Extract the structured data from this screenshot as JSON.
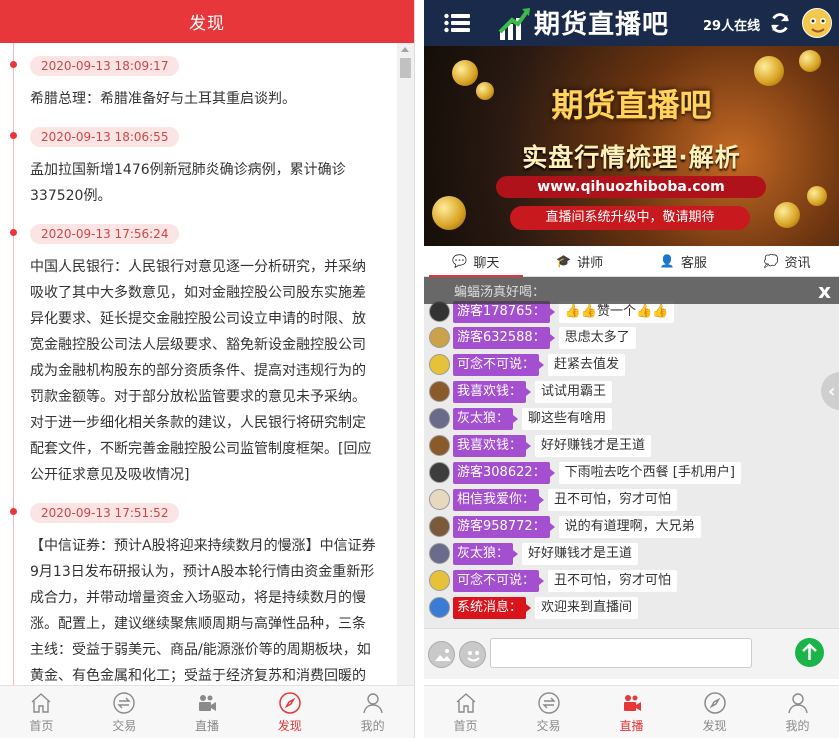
{
  "left": {
    "header_title": "发现",
    "news": [
      {
        "time": "2020-09-13 18:09:17",
        "text": "希腊总理：希腊准备好与土耳其重启谈判。"
      },
      {
        "time": "2020-09-13 18:06:55",
        "text": "孟加拉国新增1476例新冠肺炎确诊病例，累计确诊337520例。"
      },
      {
        "time": "2020-09-13 17:56:24",
        "text": "中国人民银行：人民银行对意见逐一分析研究，并采纳吸收了其中大多数意见，如对金融控股公司股东实施差异化要求、延长提交金融控股公司设立申请的时限、放宽金融控股公司法人层级要求、豁免新设金融控股公司成为金融机构股东的部分资质条件、提高对违规行为的罚款金额等。对于部分放松监管要求的意见未予采纳。对于进一步细化相关条款的建议，人民银行将研究制定配套文件，不断完善金融控股公司监管制度框架。[回应公开征求意见及吸收情况]"
      },
      {
        "time": "2020-09-13 17:51:52",
        "text": "【中信证券：预计A股将迎来持续数月的慢涨】中信证券9月13日发布研报认为，预计A股本轮行情由资金重新形成合力，并带动增量资金入场驱动，将是持续数月的慢涨。配置上，建议继续聚焦顺周期与高弹性品种，三条主线：受益于弱美元、商品/能源涨价等的周期板块，如黄金、有色金属和化工；受益于经济复苏和消费回暖的可选消费，如汽车、家电、家居等；绝"
      }
    ],
    "tabs": [
      {
        "label": "首页",
        "icon": "home-icon"
      },
      {
        "label": "交易",
        "icon": "exchange-icon"
      },
      {
        "label": "直播",
        "icon": "camera-icon"
      },
      {
        "label": "发现",
        "icon": "compass-icon"
      },
      {
        "label": "我的",
        "icon": "user-icon"
      }
    ],
    "active_tab": "发现"
  },
  "right": {
    "logo_text": "期货直播吧",
    "online_text": "29人在线",
    "banner": {
      "title": "期货直播吧",
      "subtitle": "实盘行情梳理·解析",
      "url": "www.qihuozhiboba.com",
      "notice": "直播间系统升级中，敬请期待"
    },
    "chat_tabs": [
      {
        "label": "聊天",
        "icon": "chat-icon"
      },
      {
        "label": "讲师",
        "icon": "graduation-cap-icon"
      },
      {
        "label": "客服",
        "icon": "user-icon"
      },
      {
        "label": "资讯",
        "icon": "comment-icon"
      }
    ],
    "marquee_text": "蝙蝠汤真好喝：",
    "close_label": "x",
    "messages": [
      {
        "name": "游客178765：",
        "text": "👍👍赞一个👍👍",
        "avatar_color": "#333333"
      },
      {
        "name": "游客632588：",
        "text": "思虑太多了",
        "avatar_color": "#c9a24a"
      },
      {
        "name": "可念不可说：",
        "text": "赶紧去值发",
        "avatar_color": "#e6c23a"
      },
      {
        "name": "我喜欢钱：",
        "text": "试试用霸王",
        "avatar_color": "#8b5a2b"
      },
      {
        "name": "灰太狼：",
        "text": "聊这些有啥用",
        "avatar_color": "#6a6a8a"
      },
      {
        "name": "我喜欢钱：",
        "text": "好好赚钱才是王道",
        "avatar_color": "#8b5a2b"
      },
      {
        "name": "游客308622：",
        "text": "下雨啦去吃个西餐 [手机用户]",
        "avatar_color": "#3d3d3d"
      },
      {
        "name": "相信我爱你：",
        "text": "丑不可怕，穷才可怕",
        "avatar_color": "#e8d8c0"
      },
      {
        "name": "游客958772：",
        "text": "说的有道理啊，大兄弟",
        "avatar_color": "#7a5a3a"
      },
      {
        "name": "灰太狼：",
        "text": "好好赚钱才是王道",
        "avatar_color": "#6a6a8a"
      },
      {
        "name": "可念不可说：",
        "text": "丑不可怕，穷才可怕",
        "avatar_color": "#e6c23a"
      },
      {
        "name": "系统消息：",
        "text": "欢迎来到直播间",
        "avatar_color": "#3a7bd5",
        "system": true
      }
    ],
    "tabs": [
      {
        "label": "首页",
        "icon": "home-icon"
      },
      {
        "label": "交易",
        "icon": "exchange-icon"
      },
      {
        "label": "直播",
        "icon": "camera-icon"
      },
      {
        "label": "发现",
        "icon": "compass-icon"
      },
      {
        "label": "我的",
        "icon": "user-icon"
      }
    ],
    "active_tab": "直播"
  },
  "colors": {
    "accent_red": "#e8373a",
    "header_navy": "#1a2a4a",
    "name_badge_purple": "#a44fd0",
    "send_green": "#1ab44a"
  }
}
